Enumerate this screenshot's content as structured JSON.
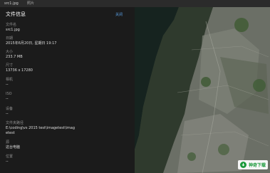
{
  "window": {
    "filename": "src1.jpg",
    "app_name": "照片"
  },
  "panel": {
    "title": "文件信息",
    "close_label": "关闭",
    "fields": [
      {
        "label": "文件名",
        "value": "src1.jpg"
      },
      {
        "label": "日期",
        "value": "2015年6月20日, 星期日 19:17"
      },
      {
        "label": "大小",
        "value": "233.7 MB"
      },
      {
        "label": "尺寸",
        "value": "13736 x 17280"
      },
      {
        "label": "相机",
        "value": "--"
      },
      {
        "label": "ISO",
        "value": "--"
      },
      {
        "label": "设备",
        "value": "--"
      },
      {
        "label": "文件夹路径",
        "value": "E:\\coding\\vs 2015 test\\imagetest\\imagetest"
      },
      {
        "label": "源",
        "value": "这台电脑"
      },
      {
        "label": "位置",
        "value": "--"
      }
    ]
  },
  "watermark": {
    "text": "神奇下载"
  },
  "colors": {
    "accent_link": "#5aa0e6",
    "watermark_green": "#1c9a3c"
  }
}
